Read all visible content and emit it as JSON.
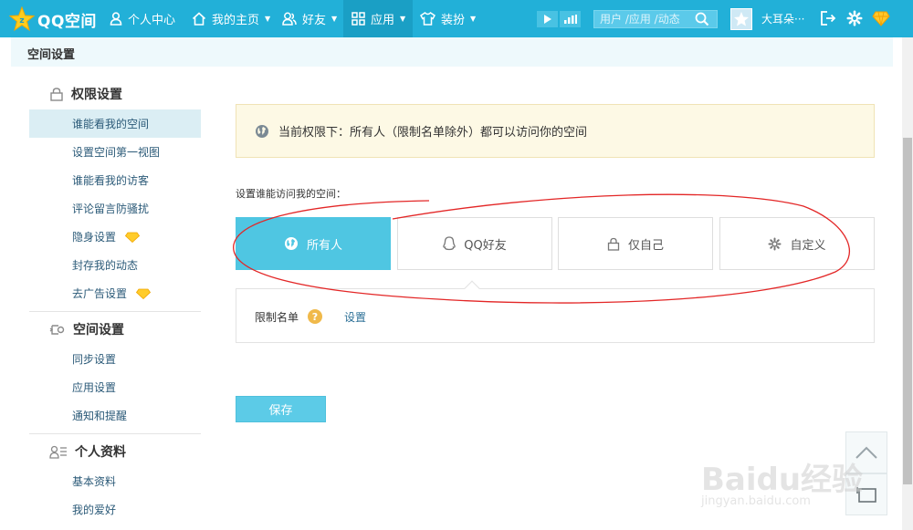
{
  "topnav": {
    "logo_text": "QQ空间",
    "items": [
      {
        "label": "个人中心",
        "icon": "person-icon"
      },
      {
        "label": "我的主页",
        "icon": "home-icon"
      },
      {
        "label": "好友",
        "icon": "friends-icon"
      },
      {
        "label": "应用",
        "icon": "apps-icon"
      },
      {
        "label": "装扮",
        "icon": "shirt-icon"
      }
    ],
    "search_placeholder": "用户 /应用 /动态",
    "username": "大耳朵···"
  },
  "header": {
    "title": "空间设置"
  },
  "sidebar": {
    "sections": [
      {
        "title": "权限设置",
        "items": [
          {
            "label": "谁能看我的空间"
          },
          {
            "label": "设置空间第一视图"
          },
          {
            "label": "谁能看我的访客"
          },
          {
            "label": "评论留言防骚扰"
          },
          {
            "label": "隐身设置"
          },
          {
            "label": "封存我的动态"
          },
          {
            "label": "去广告设置"
          }
        ]
      },
      {
        "title": "空间设置",
        "items": [
          {
            "label": "同步设置"
          },
          {
            "label": "应用设置"
          },
          {
            "label": "通知和提醒"
          }
        ]
      },
      {
        "title": "个人资料",
        "items": [
          {
            "label": "基本资料"
          },
          {
            "label": "我的爱好"
          }
        ]
      }
    ]
  },
  "main": {
    "notice": "当前权限下：所有人（限制名单除外）都可以访问你的空间",
    "setting_label": "设置谁能访问我的空间：",
    "options": [
      {
        "label": "所有人",
        "icon": "globe-icon"
      },
      {
        "label": "QQ好友",
        "icon": "penguin-icon"
      },
      {
        "label": "仅自己",
        "icon": "lock-icon"
      },
      {
        "label": "自定义",
        "icon": "gear-icon"
      }
    ],
    "selected_option": "所有人",
    "restrict_label": "限制名单",
    "restrict_help": "?",
    "restrict_link": "设置",
    "save_label": "保存"
  },
  "watermark": {
    "main": "Baidu经验",
    "sub": "jingyan.baidu.com"
  },
  "colors": {
    "topbar": "#22b0d8",
    "selected": "#4fc6e2",
    "notice_bg": "#fdf9e5",
    "annotation": "#e32626",
    "gem": "#f5c518"
  }
}
